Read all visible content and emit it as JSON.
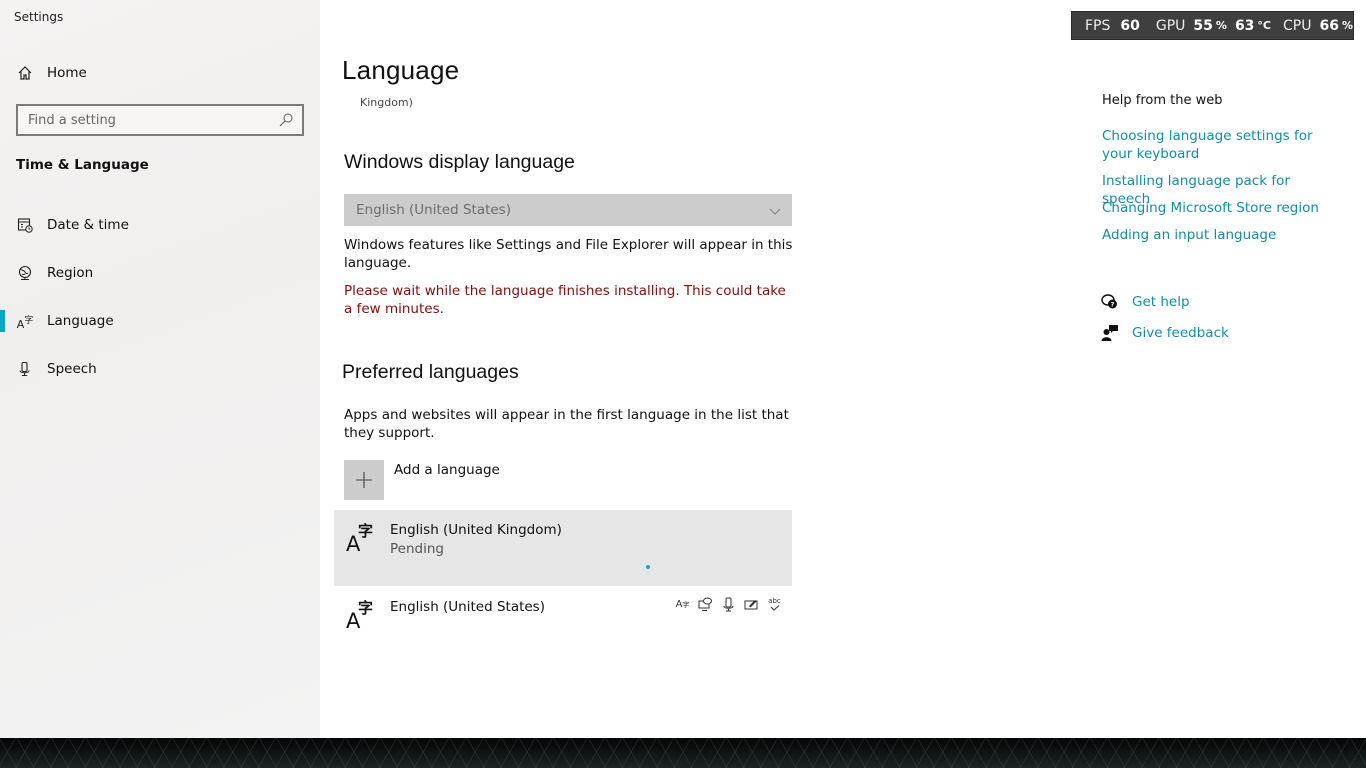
{
  "window": {
    "title": "Settings"
  },
  "sidebar": {
    "home_label": "Home",
    "search_placeholder": "Find a setting",
    "section_title": "Time & Language",
    "items": [
      {
        "label": "Date & time",
        "icon": "calendar-clock-icon"
      },
      {
        "label": "Region",
        "icon": "globe-icon"
      },
      {
        "label": "Language",
        "icon": "language-icon",
        "active": true
      },
      {
        "label": "Speech",
        "icon": "microphone-icon"
      }
    ],
    "accent_color": "#00a8c6"
  },
  "main": {
    "title": "Language",
    "subtitle_fragment": "Kingdom)",
    "display_language": {
      "heading": "Windows display language",
      "selected": "English (United States)",
      "description": "Windows features like Settings and File Explorer will appear in this language.",
      "warning": "Please wait while the language finishes installing. This could take a few minutes."
    },
    "preferred": {
      "heading": "Preferred languages",
      "description": "Apps and websites will appear in the first language in the list that they support.",
      "add_label": "Add a language",
      "languages": [
        {
          "name": "English (United Kingdom)",
          "status": "Pending",
          "selected": true
        },
        {
          "name": "English (United States)",
          "status": "",
          "features": [
            "display-language-icon",
            "text-to-speech-icon",
            "speech-recognition-icon",
            "handwriting-icon",
            "spell-check-icon"
          ]
        }
      ]
    }
  },
  "help": {
    "title": "Help from the web",
    "links": [
      "Choosing language settings for your keyboard",
      "Installing language pack for speech",
      "Changing Microsoft Store region",
      "Adding an input language"
    ],
    "get_help": "Get help",
    "give_feedback": "Give feedback",
    "link_color": "#0f8ea6"
  },
  "overlay": {
    "fps_label": "FPS",
    "fps": "60",
    "gpu_label": "GPU",
    "gpu_usage": "55",
    "gpu_usage_unit": "%",
    "gpu_temp": "63",
    "gpu_temp_unit": "°C",
    "cpu_label": "CPU",
    "cpu_usage": "66",
    "cpu_usage_unit": "%"
  }
}
